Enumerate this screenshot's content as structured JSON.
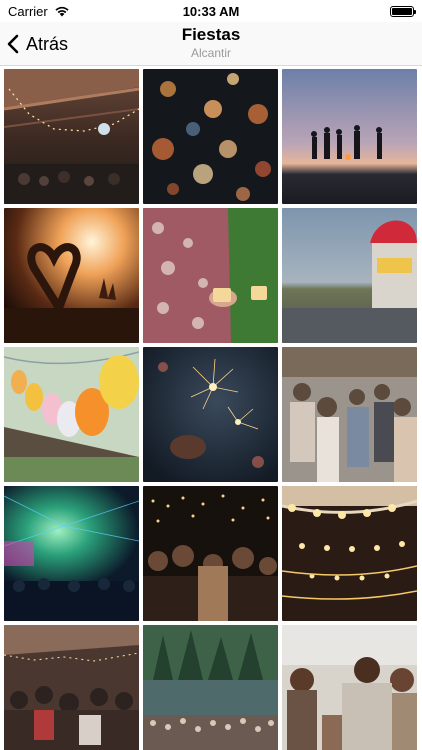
{
  "status_bar": {
    "carrier": "Carrier",
    "time": "10:33 AM",
    "icons": [
      "wifi-icon",
      "battery-icon"
    ]
  },
  "nav": {
    "back_label": "Atrás",
    "title": "Fiestas",
    "subtitle": "Alcantir",
    "back_icon": "chevron-left-icon"
  },
  "colors": {
    "nav_background": "#f9f9f9",
    "subtitle": "#9a9a9a",
    "divider": "#d8d8d8"
  },
  "gallery": {
    "photos": [
      {
        "name": "photo-terrace-string-lights"
      },
      {
        "name": "photo-bokeh-lights"
      },
      {
        "name": "photo-beach-bonfire-sunset"
      },
      {
        "name": "photo-concert-heart-hands"
      },
      {
        "name": "photo-shirt-drinks-toast"
      },
      {
        "name": "photo-food-truck"
      },
      {
        "name": "photo-balloons"
      },
      {
        "name": "photo-sparkler"
      },
      {
        "name": "photo-street-crowd"
      },
      {
        "name": "photo-stage-lasers-crowd"
      },
      {
        "name": "photo-concert-crowd-lights"
      },
      {
        "name": "photo-string-bulbs"
      },
      {
        "name": "photo-terrace-crowd"
      },
      {
        "name": "photo-festival-crowd-forest"
      },
      {
        "name": "photo-friends-festival"
      }
    ]
  }
}
